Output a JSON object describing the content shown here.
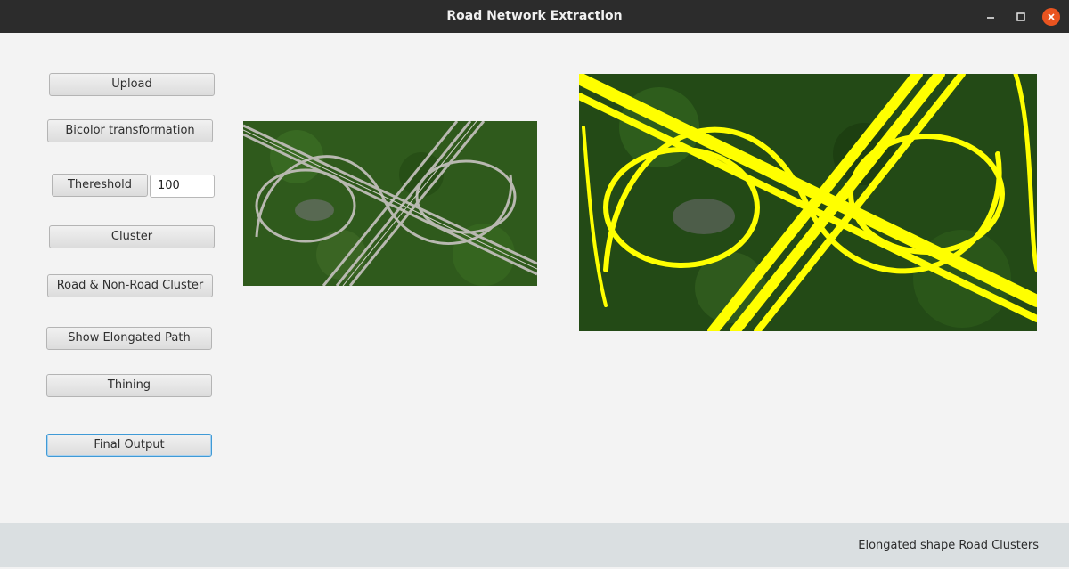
{
  "window": {
    "title": "Road Network Extraction",
    "close_color": "#e95420"
  },
  "buttons": {
    "upload": "Upload",
    "bicolor": "Bicolor transformation",
    "threshold": "Thereshold",
    "cluster": "Cluster",
    "road_nonroad": "Road & Non-Road Cluster",
    "elongated": "Show Elongated Path",
    "thinning": "Thining",
    "final_output": "Final Output"
  },
  "threshold_field": {
    "value": "100"
  },
  "images": {
    "input": {
      "description_icon": "aerial-interchange-image"
    },
    "output": {
      "description_icon": "road-overlay-image",
      "highlight_color": "#ffff00"
    }
  },
  "status": {
    "text": "Elongated shape Road Clusters"
  }
}
